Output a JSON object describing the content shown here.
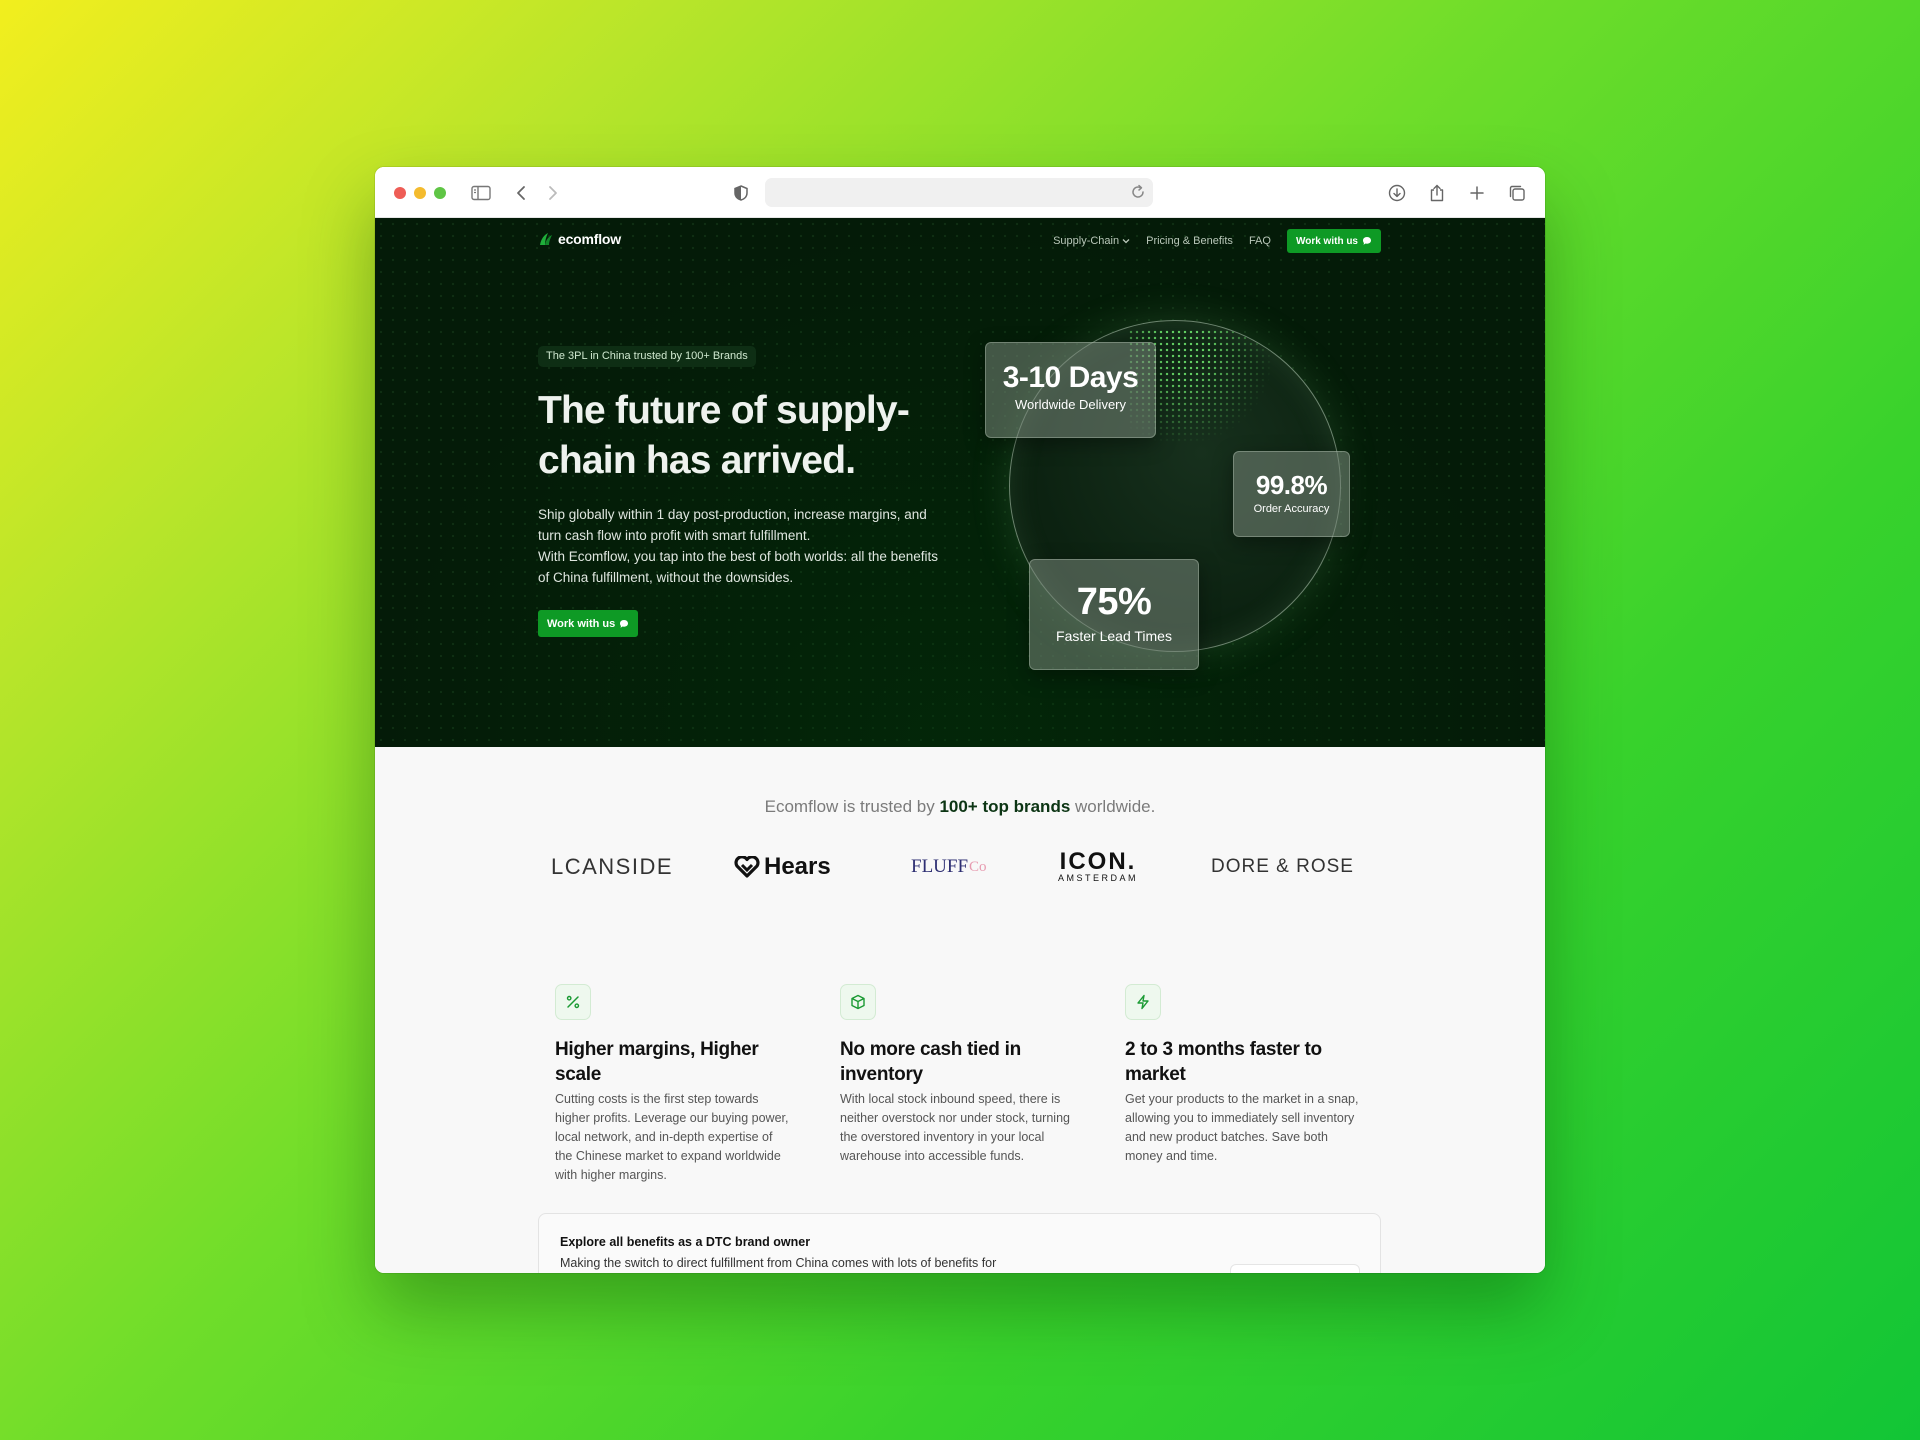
{
  "browser": {
    "url": ""
  },
  "nav": {
    "logo": "ecomflow",
    "links": [
      "Supply-Chain",
      "Pricing & Benefits",
      "FAQ"
    ],
    "cta": "Work with us"
  },
  "hero": {
    "badge": "The 3PL in China trusted by 100+ Brands",
    "title": "The future of supply-chain has arrived.",
    "subtitle_line1": "Ship globally within 1 day post-production, increase margins, and turn cash flow into profit with smart fulfillment.",
    "subtitle_line2": "With Ecomflow, you tap into the best of both worlds: all the benefits of China fulfillment, without the downsides.",
    "cta": "Work with us",
    "stats": [
      {
        "value": "3-10 Days",
        "label": "Worldwide Delivery"
      },
      {
        "value": "99.8%",
        "label": "Order Accuracy"
      },
      {
        "value": "75%",
        "label": "Faster Lead Times"
      }
    ]
  },
  "trusted": {
    "prefix": "Ecomflow is trusted by",
    "highlight": "100+ top brands",
    "suffix": "worldwide."
  },
  "brands": [
    {
      "name": "LCANSIDE"
    },
    {
      "name": "Hears"
    },
    {
      "name": "FLUFF",
      "suffix": "Co"
    },
    {
      "name": "ICON.",
      "sub": "AMSTERDAM"
    },
    {
      "name": "DORE & ROSE"
    }
  ],
  "features": [
    {
      "icon": "percent-icon",
      "title": "Higher margins, Higher scale",
      "text": "Cutting costs is the first step towards higher profits. Leverage our buying power, local network, and in-depth expertise of the Chinese market to expand worldwide with higher margins."
    },
    {
      "icon": "box-icon",
      "title": "No more cash tied in inventory",
      "text": "With local stock inbound speed, there is neither overstock nor under stock, turning the overstored inventory in your local warehouse into accessible funds."
    },
    {
      "icon": "bolt-icon",
      "title": "2 to 3 months faster to market",
      "text": "Get your products to the market in a snap, allowing you to immediately sell inventory and new product batches. Save both money and time."
    }
  ],
  "explore": {
    "title": "Explore all benefits as a DTC brand owner",
    "text": "Making the switch to direct fulfillment from China comes with lots of benefits for"
  },
  "colors": {
    "accent": "#0e9a25",
    "hero_bg": "#041b08"
  }
}
